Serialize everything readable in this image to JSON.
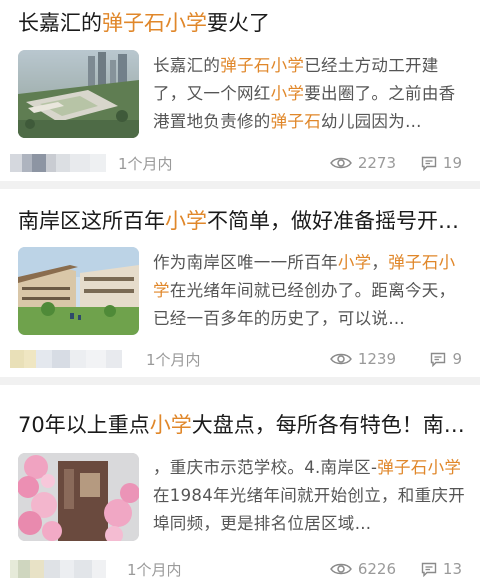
{
  "articles": [
    {
      "title_parts": [
        {
          "t": "长嘉汇的",
          "hl": false
        },
        {
          "t": "弹子石小学",
          "hl": true
        },
        {
          "t": "要火了",
          "hl": false
        }
      ],
      "snippet_parts": [
        {
          "t": "长嘉汇的",
          "hl": false
        },
        {
          "t": "弹子石小学",
          "hl": true
        },
        {
          "t": "已经土方动工开建了，又一个网红",
          "hl": false
        },
        {
          "t": "小学",
          "hl": true
        },
        {
          "t": "要出圈了。之前由香港置地负责修的",
          "hl": false
        },
        {
          "t": "弹子石",
          "hl": true
        },
        {
          "t": "幼儿园因为…",
          "hl": false
        }
      ],
      "time": "1个月内",
      "views": "2273",
      "comments": "19"
    },
    {
      "title_parts": [
        {
          "t": "南岸区这所百年",
          "hl": false
        },
        {
          "t": "小学",
          "hl": true
        },
        {
          "t": "不简单，做好准备摇号开…",
          "hl": false
        }
      ],
      "snippet_parts": [
        {
          "t": "作为南岸区唯一一所百年",
          "hl": false
        },
        {
          "t": "小学",
          "hl": true
        },
        {
          "t": "，",
          "hl": false
        },
        {
          "t": "弹子石小学",
          "hl": true
        },
        {
          "t": "在光绪年间就已经创办了。距离今天，已经一百多年的历史了，可以说…",
          "hl": false
        }
      ],
      "time": "1个月内",
      "views": "1239",
      "comments": "9"
    },
    {
      "title_parts": [
        {
          "t": "70年以上重点",
          "hl": false
        },
        {
          "t": "小学",
          "hl": true
        },
        {
          "t": "大盘点，每所各有特色！南…",
          "hl": false
        }
      ],
      "snippet_parts": [
        {
          "t": "，重庆市示范学校。4.南岸区-",
          "hl": false
        },
        {
          "t": "弹子石小学",
          "hl": true
        },
        {
          "t": "在1984年光绪年间就开始创立，和重庆开埠同频，更是排名位居区域…",
          "hl": false
        }
      ],
      "time": "1个月内",
      "views": "6226",
      "comments": "13"
    }
  ],
  "icons": {
    "views": "eye-icon",
    "comments": "comment-icon"
  },
  "colors": {
    "highlight": "#e0872a",
    "meta": "#9a9a9a",
    "separator": "#f1f1f1"
  }
}
